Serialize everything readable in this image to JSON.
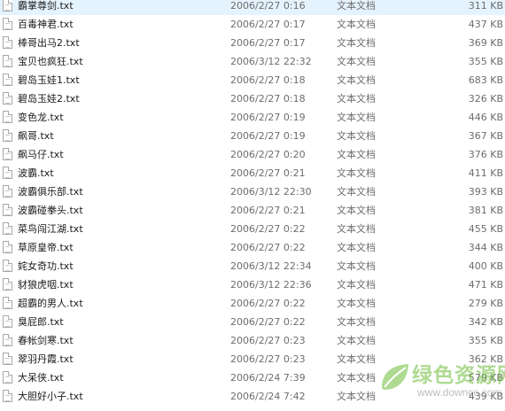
{
  "files": [
    {
      "name": "霸掌尊剑.txt",
      "modified": "2006/2/27 0:16",
      "type": "文本文档",
      "size": "311 KB"
    },
    {
      "name": "百毒神君.txt",
      "modified": "2006/2/27 0:17",
      "type": "文本文档",
      "size": "437 KB"
    },
    {
      "name": "棒哥出马2.txt",
      "modified": "2006/2/27 0:17",
      "type": "文本文档",
      "size": "369 KB"
    },
    {
      "name": "宝贝也疯狂.txt",
      "modified": "2006/3/12 22:32",
      "type": "文本文档",
      "size": "355 KB"
    },
    {
      "name": "碧岛玉娃1.txt",
      "modified": "2006/2/27 0:18",
      "type": "文本文档",
      "size": "683 KB"
    },
    {
      "name": "碧岛玉娃2.txt",
      "modified": "2006/2/27 0:18",
      "type": "文本文档",
      "size": "326 KB"
    },
    {
      "name": "变色龙.txt",
      "modified": "2006/2/27 0:19",
      "type": "文本文档",
      "size": "446 KB"
    },
    {
      "name": "飙哥.txt",
      "modified": "2006/2/27 0:19",
      "type": "文本文档",
      "size": "367 KB"
    },
    {
      "name": "飙马仔.txt",
      "modified": "2006/2/27 0:20",
      "type": "文本文档",
      "size": "376 KB"
    },
    {
      "name": "波霸.txt",
      "modified": "2006/2/27 0:21",
      "type": "文本文档",
      "size": "411 KB"
    },
    {
      "name": "波霸俱乐部.txt",
      "modified": "2006/3/12 22:30",
      "type": "文本文档",
      "size": "393 KB"
    },
    {
      "name": "波霸碰拳头.txt",
      "modified": "2006/2/27 0:21",
      "type": "文本文档",
      "size": "381 KB"
    },
    {
      "name": "菜鸟闯江湖.txt",
      "modified": "2006/2/27 0:22",
      "type": "文本文档",
      "size": "455 KB"
    },
    {
      "name": "草原皇帝.txt",
      "modified": "2006/2/27 0:22",
      "type": "文本文档",
      "size": "344 KB"
    },
    {
      "name": "姹女奇功.txt",
      "modified": "2006/3/12 22:34",
      "type": "文本文档",
      "size": "400 KB"
    },
    {
      "name": "豺狼虎咽.txt",
      "modified": "2006/3/12 22:36",
      "type": "文本文档",
      "size": "471 KB"
    },
    {
      "name": "超霸的男人.txt",
      "modified": "2006/2/27 0:22",
      "type": "文本文档",
      "size": "279 KB"
    },
    {
      "name": "臭屁郎.txt",
      "modified": "2006/2/27 0:22",
      "type": "文本文档",
      "size": "342 KB"
    },
    {
      "name": "春帐剑寒.txt",
      "modified": "2006/2/27 0:23",
      "type": "文本文档",
      "size": "355 KB"
    },
    {
      "name": "翠羽丹霞.txt",
      "modified": "2006/2/27 0:23",
      "type": "文本文档",
      "size": "362 KB"
    },
    {
      "name": "大呆侠.txt",
      "modified": "2006/2/24 7:39",
      "type": "文本文档",
      "size": "579 KB"
    },
    {
      "name": "大胆好小子.txt",
      "modified": "2006/2/24 7:42",
      "type": "文本文档",
      "size": "439 KB"
    }
  ],
  "watermark": {
    "title": "绿色资源网",
    "url": "www.downcc.com",
    "color": "#6dbd3a"
  }
}
